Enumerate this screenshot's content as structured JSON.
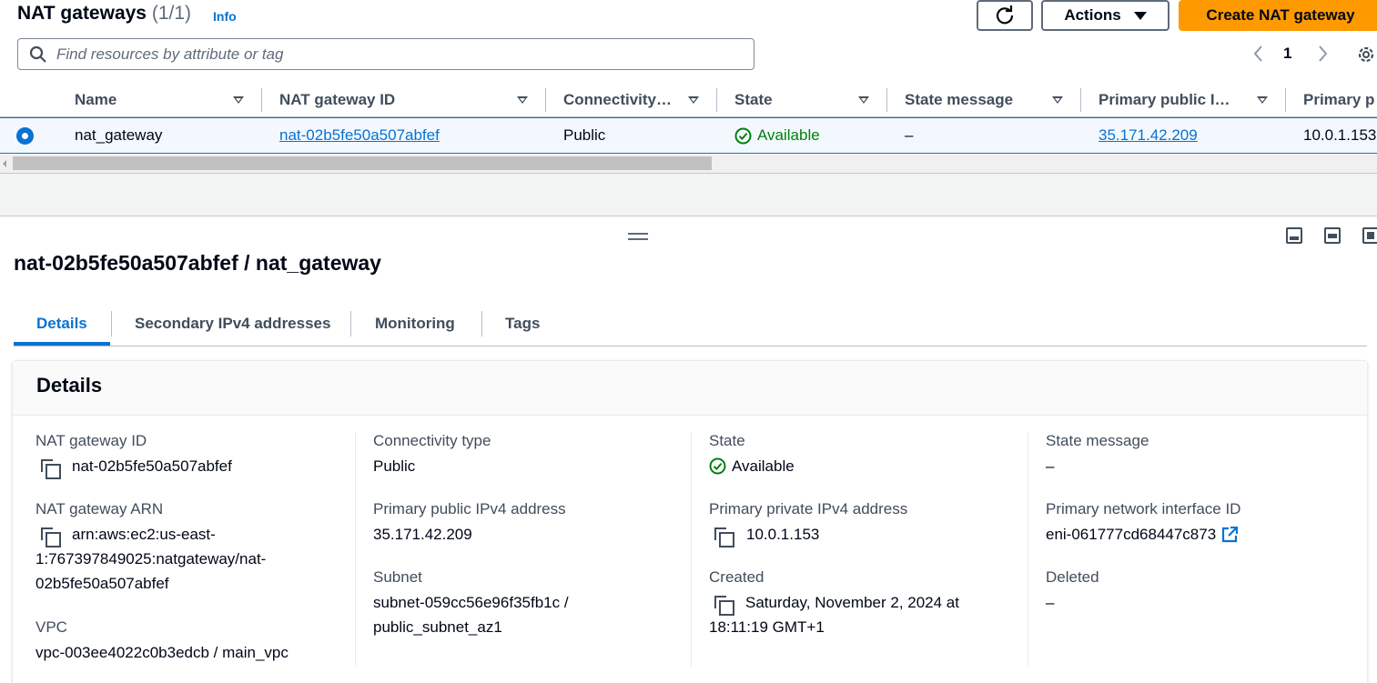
{
  "header": {
    "title": "NAT gateways",
    "count": "(1/1)",
    "info": "Info",
    "actions_label": "Actions",
    "create_label": "Create NAT gateway"
  },
  "search": {
    "placeholder": "Find resources by attribute or tag"
  },
  "pagination": {
    "current_page": "1"
  },
  "table": {
    "columns": [
      "Name",
      "NAT gateway ID",
      "Connectivity…",
      "State",
      "State message",
      "Primary public I…",
      "Primary p"
    ],
    "rows": [
      {
        "name": "nat_gateway",
        "nat_gateway_id": "nat-02b5fe50a507abfef",
        "connectivity": "Public",
        "state": "Available",
        "state_message": "–",
        "primary_public_ip": "35.171.42.209",
        "primary_private_ip": "10.0.1.153"
      }
    ]
  },
  "split_panel": {
    "title": "nat-02b5fe50a507abfef / nat_gateway",
    "tabs": [
      "Details",
      "Secondary IPv4 addresses",
      "Monitoring",
      "Tags"
    ],
    "active_tab": "Details"
  },
  "details": {
    "heading": "Details",
    "nat_gateway_id_label": "NAT gateway ID",
    "nat_gateway_id": "nat-02b5fe50a507abfef",
    "arn_label": "NAT gateway ARN",
    "arn_line1": "arn:aws:ec2:us-east-",
    "arn_line2": "1:767397849025:natgateway/nat-",
    "arn_line3": "02b5fe50a507abfef",
    "vpc_label": "VPC",
    "vpc": "vpc-003ee4022c0b3edcb / main_vpc",
    "connectivity_label": "Connectivity type",
    "connectivity": "Public",
    "public_ip_label": "Primary public IPv4 address",
    "public_ip": "35.171.42.209",
    "subnet_label": "Subnet",
    "subnet_line1": "subnet-059cc56e96f35fb1c /",
    "subnet_line2": "public_subnet_az1",
    "state_label": "State",
    "state": "Available",
    "private_ip_label": "Primary private IPv4 address",
    "private_ip": "10.0.1.153",
    "created_label": "Created",
    "created_line1": "Saturday, November 2, 2024 at",
    "created_line2": "18:11:19 GMT+1",
    "state_message_label": "State message",
    "state_message": "–",
    "eni_label": "Primary network interface ID",
    "eni": "eni-061777cd68447c873",
    "deleted_label": "Deleted",
    "deleted": "–"
  },
  "colors": {
    "link": "#0972d3",
    "success": "#037f0c",
    "primary_button": "#ff9900",
    "selected_row": "#f2f8fd"
  }
}
